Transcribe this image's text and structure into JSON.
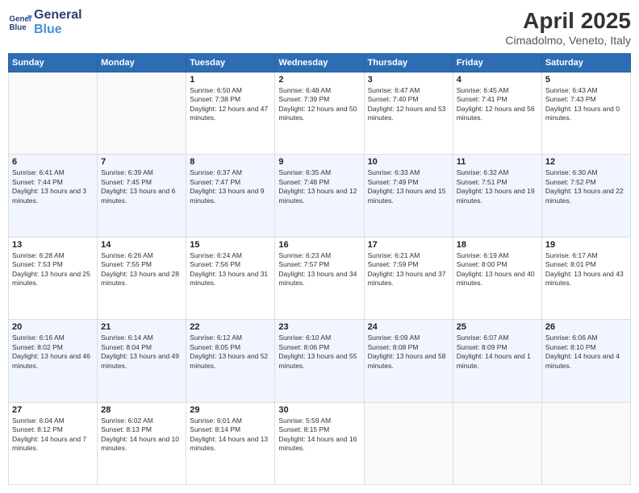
{
  "header": {
    "logo_line1": "General",
    "logo_line2": "Blue",
    "title": "April 2025",
    "subtitle": "Cimadolmo, Veneto, Italy"
  },
  "weekdays": [
    "Sunday",
    "Monday",
    "Tuesday",
    "Wednesday",
    "Thursday",
    "Friday",
    "Saturday"
  ],
  "weeks": [
    [
      {
        "day": "",
        "empty": true
      },
      {
        "day": "",
        "empty": true
      },
      {
        "day": "1",
        "sunrise": "6:50 AM",
        "sunset": "7:38 PM",
        "daylight": "12 hours and 47 minutes."
      },
      {
        "day": "2",
        "sunrise": "6:48 AM",
        "sunset": "7:39 PM",
        "daylight": "12 hours and 50 minutes."
      },
      {
        "day": "3",
        "sunrise": "6:47 AM",
        "sunset": "7:40 PM",
        "daylight": "12 hours and 53 minutes."
      },
      {
        "day": "4",
        "sunrise": "6:45 AM",
        "sunset": "7:41 PM",
        "daylight": "12 hours and 56 minutes."
      },
      {
        "day": "5",
        "sunrise": "6:43 AM",
        "sunset": "7:43 PM",
        "daylight": "13 hours and 0 minutes."
      }
    ],
    [
      {
        "day": "6",
        "sunrise": "6:41 AM",
        "sunset": "7:44 PM",
        "daylight": "13 hours and 3 minutes."
      },
      {
        "day": "7",
        "sunrise": "6:39 AM",
        "sunset": "7:45 PM",
        "daylight": "13 hours and 6 minutes."
      },
      {
        "day": "8",
        "sunrise": "6:37 AM",
        "sunset": "7:47 PM",
        "daylight": "13 hours and 9 minutes."
      },
      {
        "day": "9",
        "sunrise": "6:35 AM",
        "sunset": "7:48 PM",
        "daylight": "13 hours and 12 minutes."
      },
      {
        "day": "10",
        "sunrise": "6:33 AM",
        "sunset": "7:49 PM",
        "daylight": "13 hours and 15 minutes."
      },
      {
        "day": "11",
        "sunrise": "6:32 AM",
        "sunset": "7:51 PM",
        "daylight": "13 hours and 19 minutes."
      },
      {
        "day": "12",
        "sunrise": "6:30 AM",
        "sunset": "7:52 PM",
        "daylight": "13 hours and 22 minutes."
      }
    ],
    [
      {
        "day": "13",
        "sunrise": "6:28 AM",
        "sunset": "7:53 PM",
        "daylight": "13 hours and 25 minutes."
      },
      {
        "day": "14",
        "sunrise": "6:26 AM",
        "sunset": "7:55 PM",
        "daylight": "13 hours and 28 minutes."
      },
      {
        "day": "15",
        "sunrise": "6:24 AM",
        "sunset": "7:56 PM",
        "daylight": "13 hours and 31 minutes."
      },
      {
        "day": "16",
        "sunrise": "6:23 AM",
        "sunset": "7:57 PM",
        "daylight": "13 hours and 34 minutes."
      },
      {
        "day": "17",
        "sunrise": "6:21 AM",
        "sunset": "7:59 PM",
        "daylight": "13 hours and 37 minutes."
      },
      {
        "day": "18",
        "sunrise": "6:19 AM",
        "sunset": "8:00 PM",
        "daylight": "13 hours and 40 minutes."
      },
      {
        "day": "19",
        "sunrise": "6:17 AM",
        "sunset": "8:01 PM",
        "daylight": "13 hours and 43 minutes."
      }
    ],
    [
      {
        "day": "20",
        "sunrise": "6:16 AM",
        "sunset": "8:02 PM",
        "daylight": "13 hours and 46 minutes."
      },
      {
        "day": "21",
        "sunrise": "6:14 AM",
        "sunset": "8:04 PM",
        "daylight": "13 hours and 49 minutes."
      },
      {
        "day": "22",
        "sunrise": "6:12 AM",
        "sunset": "8:05 PM",
        "daylight": "13 hours and 52 minutes."
      },
      {
        "day": "23",
        "sunrise": "6:10 AM",
        "sunset": "8:06 PM",
        "daylight": "13 hours and 55 minutes."
      },
      {
        "day": "24",
        "sunrise": "6:09 AM",
        "sunset": "8:08 PM",
        "daylight": "13 hours and 58 minutes."
      },
      {
        "day": "25",
        "sunrise": "6:07 AM",
        "sunset": "8:09 PM",
        "daylight": "14 hours and 1 minute."
      },
      {
        "day": "26",
        "sunrise": "6:06 AM",
        "sunset": "8:10 PM",
        "daylight": "14 hours and 4 minutes."
      }
    ],
    [
      {
        "day": "27",
        "sunrise": "6:04 AM",
        "sunset": "8:12 PM",
        "daylight": "14 hours and 7 minutes."
      },
      {
        "day": "28",
        "sunrise": "6:02 AM",
        "sunset": "8:13 PM",
        "daylight": "14 hours and 10 minutes."
      },
      {
        "day": "29",
        "sunrise": "6:01 AM",
        "sunset": "8:14 PM",
        "daylight": "14 hours and 13 minutes."
      },
      {
        "day": "30",
        "sunrise": "5:59 AM",
        "sunset": "8:15 PM",
        "daylight": "14 hours and 16 minutes."
      },
      {
        "day": "",
        "empty": true
      },
      {
        "day": "",
        "empty": true
      },
      {
        "day": "",
        "empty": true
      }
    ]
  ],
  "labels": {
    "sunrise_prefix": "Sunrise: ",
    "sunset_prefix": "Sunset: ",
    "daylight_prefix": "Daylight: "
  }
}
